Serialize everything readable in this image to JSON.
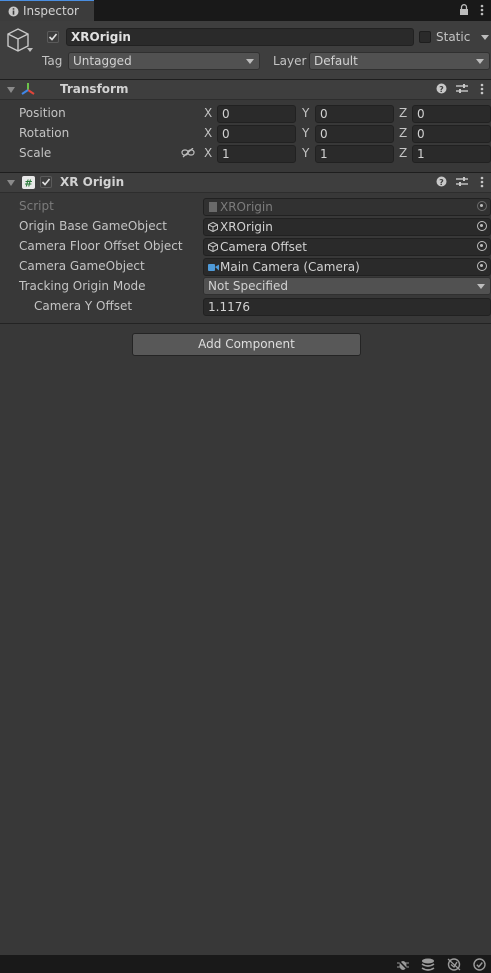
{
  "window": {
    "tab_title": "Inspector"
  },
  "gameobject": {
    "active": true,
    "name": "XROrigin",
    "static_label": "Static",
    "static_checked": false,
    "tag_label": "Tag",
    "tag_value": "Untagged",
    "layer_label": "Layer",
    "layer_value": "Default"
  },
  "transform": {
    "title": "Transform",
    "rows": [
      {
        "label": "Position",
        "x": "0",
        "y": "0",
        "z": "0"
      },
      {
        "label": "Rotation",
        "x": "0",
        "y": "0",
        "z": "0"
      },
      {
        "label": "Scale",
        "x": "1",
        "y": "1",
        "z": "1"
      }
    ],
    "axis_labels": {
      "x": "X",
      "y": "Y",
      "z": "Z"
    }
  },
  "xr_origin": {
    "title": "XR Origin",
    "enabled": true,
    "script_label": "Script",
    "script_value": "XROrigin",
    "origin_base_label": "Origin Base GameObject",
    "origin_base_value": "XROrigin",
    "camera_floor_label": "Camera Floor Offset Object",
    "camera_floor_value": "Camera Offset",
    "camera_go_label": "Camera GameObject",
    "camera_go_value": "Main Camera (Camera)",
    "tracking_mode_label": "Tracking Origin Mode",
    "tracking_mode_value": "Not Specified",
    "camera_y_label": "Camera Y Offset",
    "camera_y_value": "1.1176"
  },
  "add_component_label": "Add Component",
  "colors": {
    "accent": "#4a8ee0",
    "background": "#383838",
    "field": "#2a2a2a"
  }
}
